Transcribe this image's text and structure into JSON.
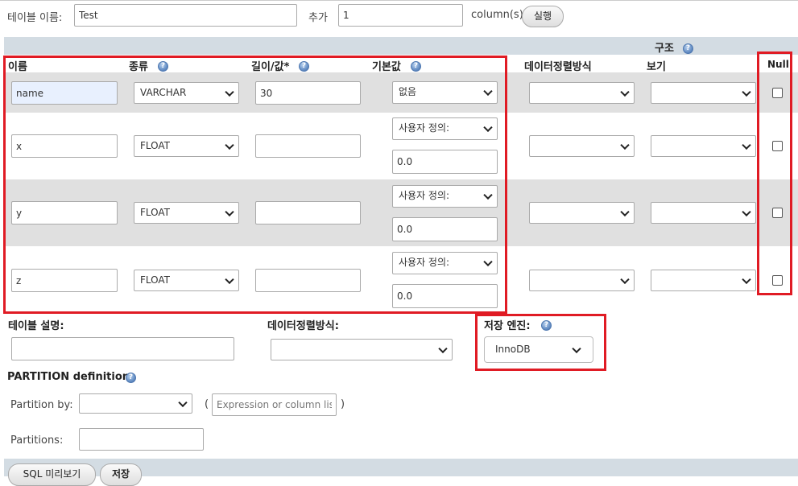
{
  "top": {
    "table_name_label": "테이블 이름:",
    "table_name_value": "Test",
    "add_label": "추가",
    "add_count": "1",
    "columns_label": "column(s)",
    "go_button": "실행"
  },
  "structure": {
    "title": "구조",
    "headers": {
      "name": "이름",
      "type": "종류",
      "length": "길이/값*",
      "default": "기본값",
      "collation": "데이터정렬방식",
      "attributes": "보기",
      "null": "Null"
    },
    "rows": [
      {
        "name": "name",
        "type": "VARCHAR",
        "length": "30",
        "default_option": "없음",
        "default_value": ""
      },
      {
        "name": "x",
        "type": "FLOAT",
        "length": "",
        "default_option": "사용자 정의:",
        "default_value": "0.0"
      },
      {
        "name": "y",
        "type": "FLOAT",
        "length": "",
        "default_option": "사용자 정의:",
        "default_value": "0.0"
      },
      {
        "name": "z",
        "type": "FLOAT",
        "length": "",
        "default_option": "사용자 정의:",
        "default_value": "0.0"
      }
    ]
  },
  "table_options": {
    "comment_label": "테이블 설명:",
    "collation_label": "데이터정렬방식:",
    "engine_label": "저장 엔진:",
    "engine_value": "InnoDB"
  },
  "partition": {
    "title": "PARTITION definition:",
    "partition_by_label": "Partition by:",
    "open_paren": "(",
    "expression_placeholder": "Expression or column list",
    "close_paren": ")",
    "partitions_label": "Partitions:"
  },
  "footer": {
    "preview_button": "SQL 미리보기",
    "save_button": "저장"
  },
  "colors": {
    "highlight_red": "#e01b24",
    "row_gray": "#e0e0e0",
    "header_bar": "#d3dce3"
  }
}
